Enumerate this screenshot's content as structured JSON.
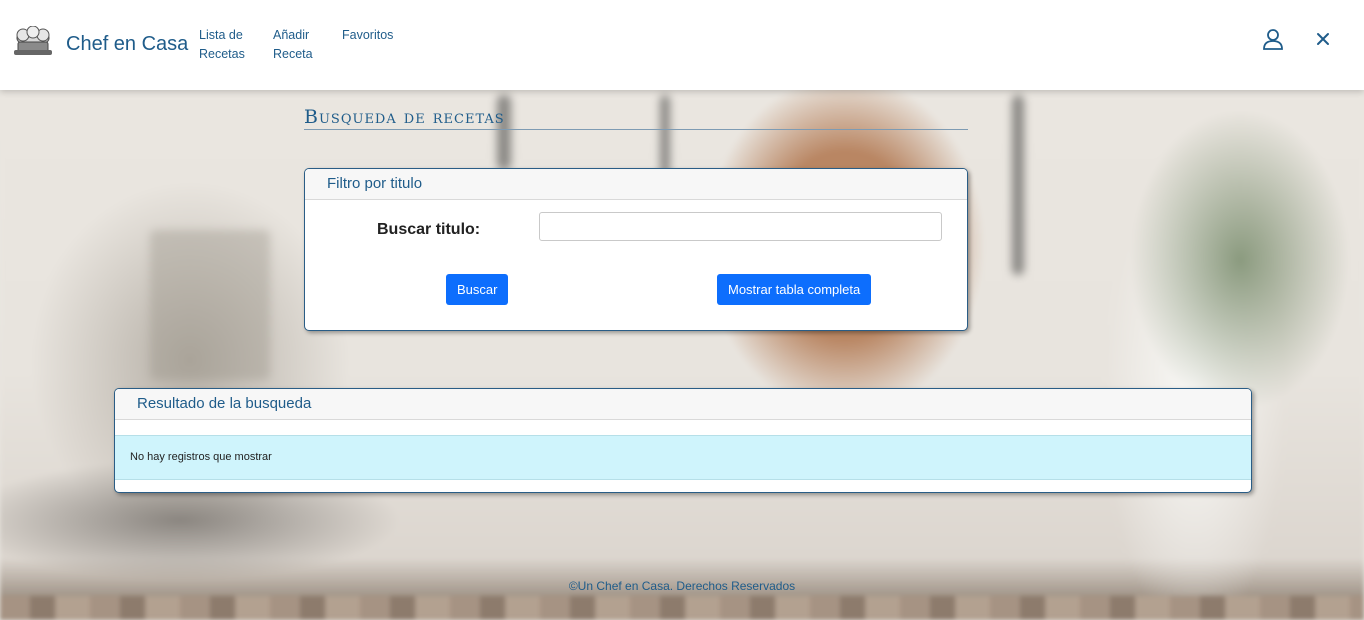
{
  "navbar": {
    "brand": "Chef en Casa",
    "items": [
      {
        "line1": "Lista de",
        "line2": "Recetas"
      },
      {
        "line1": "Añadir",
        "line2": "Receta"
      },
      {
        "line1": "Favoritos",
        "line2": ""
      }
    ],
    "icons": [
      "chef-hat-logo",
      "user-icon",
      "close-icon"
    ]
  },
  "page": {
    "title": "Busqueda de recetas"
  },
  "filter": {
    "header": "Filtro por titulo",
    "label": "Buscar titulo:",
    "input_value": "",
    "buscar_label": "Buscar",
    "tabla_label": "Mostrar tabla completa"
  },
  "results": {
    "header": "Resultado de la busqueda",
    "empty_message": "No hay registros que mostrar"
  },
  "footer": {
    "text": "©Un Chef en Casa. Derechos Reservados"
  },
  "colors": {
    "brand": "#1f5c8a",
    "button": "#0d6efd",
    "info_row": "#cff4fc"
  }
}
